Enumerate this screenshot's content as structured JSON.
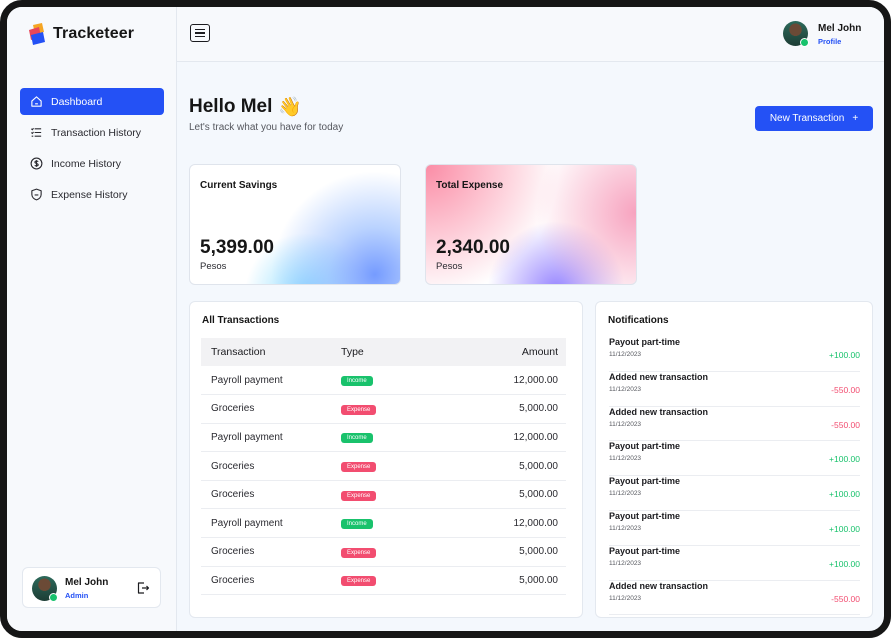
{
  "app": {
    "name": "Tracketeer"
  },
  "sidebar": {
    "items": [
      {
        "label": "Dashboard",
        "icon": "home-icon",
        "active": true
      },
      {
        "label": "Transaction History",
        "icon": "list-icon",
        "active": false
      },
      {
        "label": "Income History",
        "icon": "dollar-circle-icon",
        "active": false
      },
      {
        "label": "Expense History",
        "icon": "shield-icon",
        "active": false
      }
    ],
    "user": {
      "name": "Mel John",
      "role": "Admin",
      "status": "online"
    }
  },
  "topbar": {
    "user": {
      "name": "Mel John",
      "link": "Profile",
      "status": "online"
    }
  },
  "greeting": {
    "title": "Hello Mel",
    "emoji": "👋",
    "subtitle": "Let's track what you have for today"
  },
  "actions": {
    "new_transaction": "New Transaction",
    "new_transaction_icon": "+"
  },
  "stats": {
    "savings": {
      "title": "Current Savings",
      "value": "5,399.00",
      "unit": "Pesos"
    },
    "expense": {
      "title": "Total Expense",
      "value": "2,340.00",
      "unit": "Pesos"
    }
  },
  "transactions": {
    "title": "All Transactions",
    "columns": [
      "Transaction",
      "Type",
      "Amount"
    ],
    "rows": [
      {
        "name": "Payroll payment",
        "type": "Income",
        "amount": "12,000.00"
      },
      {
        "name": "Groceries",
        "type": "Expense",
        "amount": "5,000.00"
      },
      {
        "name": "Payroll payment",
        "type": "Income",
        "amount": "12,000.00"
      },
      {
        "name": "Groceries",
        "type": "Expense",
        "amount": "5,000.00"
      },
      {
        "name": "Groceries",
        "type": "Expense",
        "amount": "5,000.00"
      },
      {
        "name": "Payroll payment",
        "type": "Income",
        "amount": "12,000.00"
      },
      {
        "name": "Groceries",
        "type": "Expense",
        "amount": "5,000.00"
      },
      {
        "name": "Groceries",
        "type": "Expense",
        "amount": "5,000.00"
      }
    ]
  },
  "notifications": {
    "title": "Notifications",
    "items": [
      {
        "title": "Payout part-time",
        "date": "11/12/2023",
        "amount": "+100.00"
      },
      {
        "title": "Added new transaction",
        "date": "11/12/2023",
        "amount": "-550.00"
      },
      {
        "title": "Added new transaction",
        "date": "11/12/2023",
        "amount": "-550.00"
      },
      {
        "title": "Payout part-time",
        "date": "11/12/2023",
        "amount": "+100.00"
      },
      {
        "title": "Payout part-time",
        "date": "11/12/2023",
        "amount": "+100.00"
      },
      {
        "title": "Payout part-time",
        "date": "11/12/2023",
        "amount": "+100.00"
      },
      {
        "title": "Payout part-time",
        "date": "11/12/2023",
        "amount": "+100.00"
      },
      {
        "title": "Added new transaction",
        "date": "11/12/2023",
        "amount": "-550.00"
      }
    ]
  },
  "colors": {
    "accent": "#2451f5",
    "income": "#19c26c",
    "expense": "#f24d70",
    "online": "#18c26d"
  }
}
